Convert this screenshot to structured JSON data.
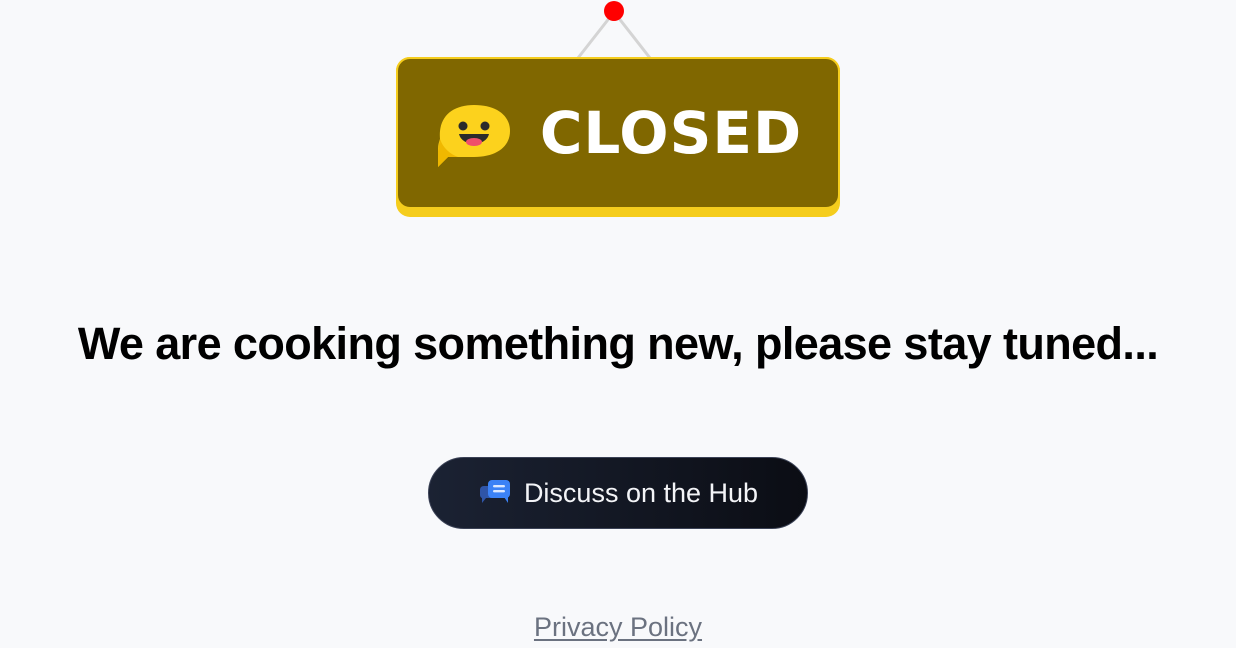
{
  "sign": {
    "text": "CLOSED",
    "logo_icon": "hugging-face-speech-bubble-icon",
    "colors": {
      "panel": "#806700",
      "border": "#f5cd1d",
      "text": "#ffffff",
      "pin": "#ff0000",
      "string": "#d4d4d4"
    }
  },
  "headline": "We are cooking something new, please stay tuned...",
  "hub_button": {
    "label": "Discuss on the Hub",
    "icon": "chat-bubbles-icon",
    "colors": {
      "background": "#0b0d14",
      "icon": "#3b82f6",
      "text": "#f3f4f7"
    }
  },
  "footer": {
    "privacy_link": "Privacy Policy"
  }
}
